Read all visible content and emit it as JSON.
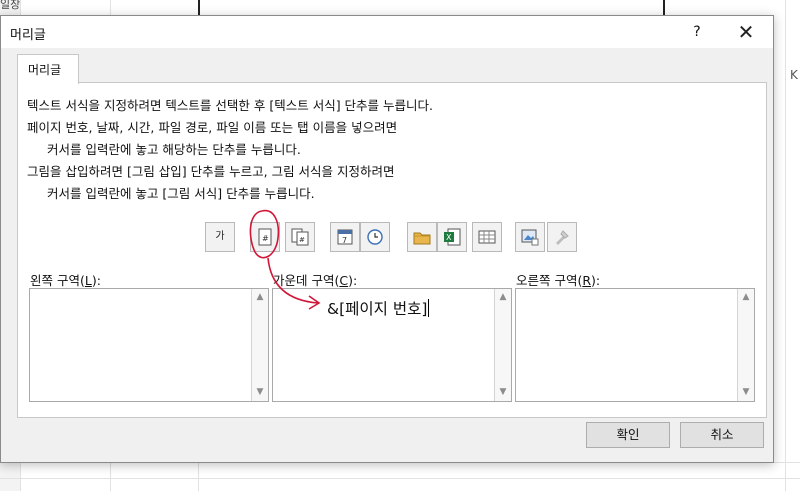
{
  "background": {
    "top_label": "일장",
    "right_label": "K"
  },
  "dialog": {
    "title": "머리글",
    "help_label": "?",
    "close_label": "✕",
    "tab_label": "머리글",
    "instructions": [
      "텍스트 서식을 지정하려면 텍스트를 선택한 후 [텍스트 서식] 단추를 누릅니다.",
      "페이지 번호, 날짜, 시간, 파일 경로, 파일 이름 또는 탭 이름을 넣으려면",
      "커서를 입력란에 놓고 해당하는 단추를 누릅니다.",
      "그림을 삽입하려면 [그림 삽입] 단추를 누르고, 그림 서식을 지정하려면",
      "커서를 입력란에 놓고 [그림 서식] 단추를 누릅니다."
    ],
    "toolbar": {
      "format_text_glyph": "가"
    },
    "sections": {
      "left": {
        "label_pre": "왼쪽 구역(",
        "accel": "L",
        "label_post": "):",
        "value": ""
      },
      "center": {
        "label_pre": "가운데 구역(",
        "accel": "C",
        "label_post": "):",
        "value": "&[페이지 번호]"
      },
      "right": {
        "label_pre": "오른쪽 구역(",
        "accel": "R",
        "label_post": "):",
        "value": ""
      }
    },
    "buttons": {
      "ok": "확인",
      "cancel": "취소"
    }
  },
  "colors": {
    "annotation": "#d0193a",
    "dialog_bg": "#f0f0f0"
  }
}
